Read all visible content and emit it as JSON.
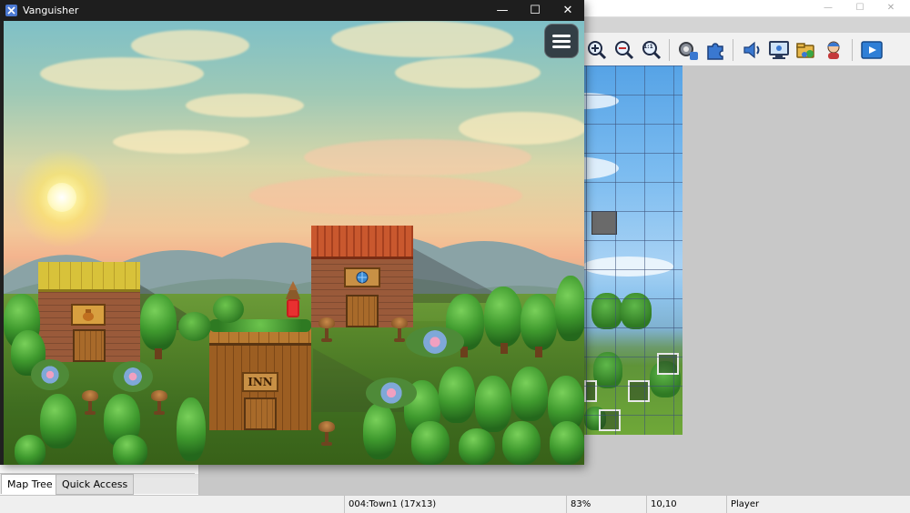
{
  "game_window": {
    "title": "Vanguisher",
    "controls": {
      "minimize": "—",
      "maximize": "☐",
      "close": "✕"
    },
    "menu_icon": "hamburger-menu-icon",
    "inn_sign": "INN"
  },
  "editor": {
    "window_controls": {
      "minimize": "—",
      "maximize": "☐",
      "close": "✕"
    },
    "toolbar_icons": [
      "zoom-in-icon",
      "zoom-out-icon",
      "zoom-actual-size-icon",
      "database-icon",
      "plugin-manager-icon",
      "sound-test-icon",
      "event-searcher-icon",
      "resource-manager-icon",
      "character-generator-icon",
      "playtest-icon"
    ],
    "zoom_actual_label": "1:1",
    "tabs": [
      "Map Tree",
      "Quick Access"
    ],
    "status": {
      "map": "004:Town1 (17x13)",
      "zoom": "83%",
      "coords": "10,10",
      "mode": "Player"
    }
  },
  "colors": {
    "game_titlebar": "#1e1e1e",
    "editor_bg": "#d4d4d4",
    "playtest_accent": "#2f7fd6"
  }
}
